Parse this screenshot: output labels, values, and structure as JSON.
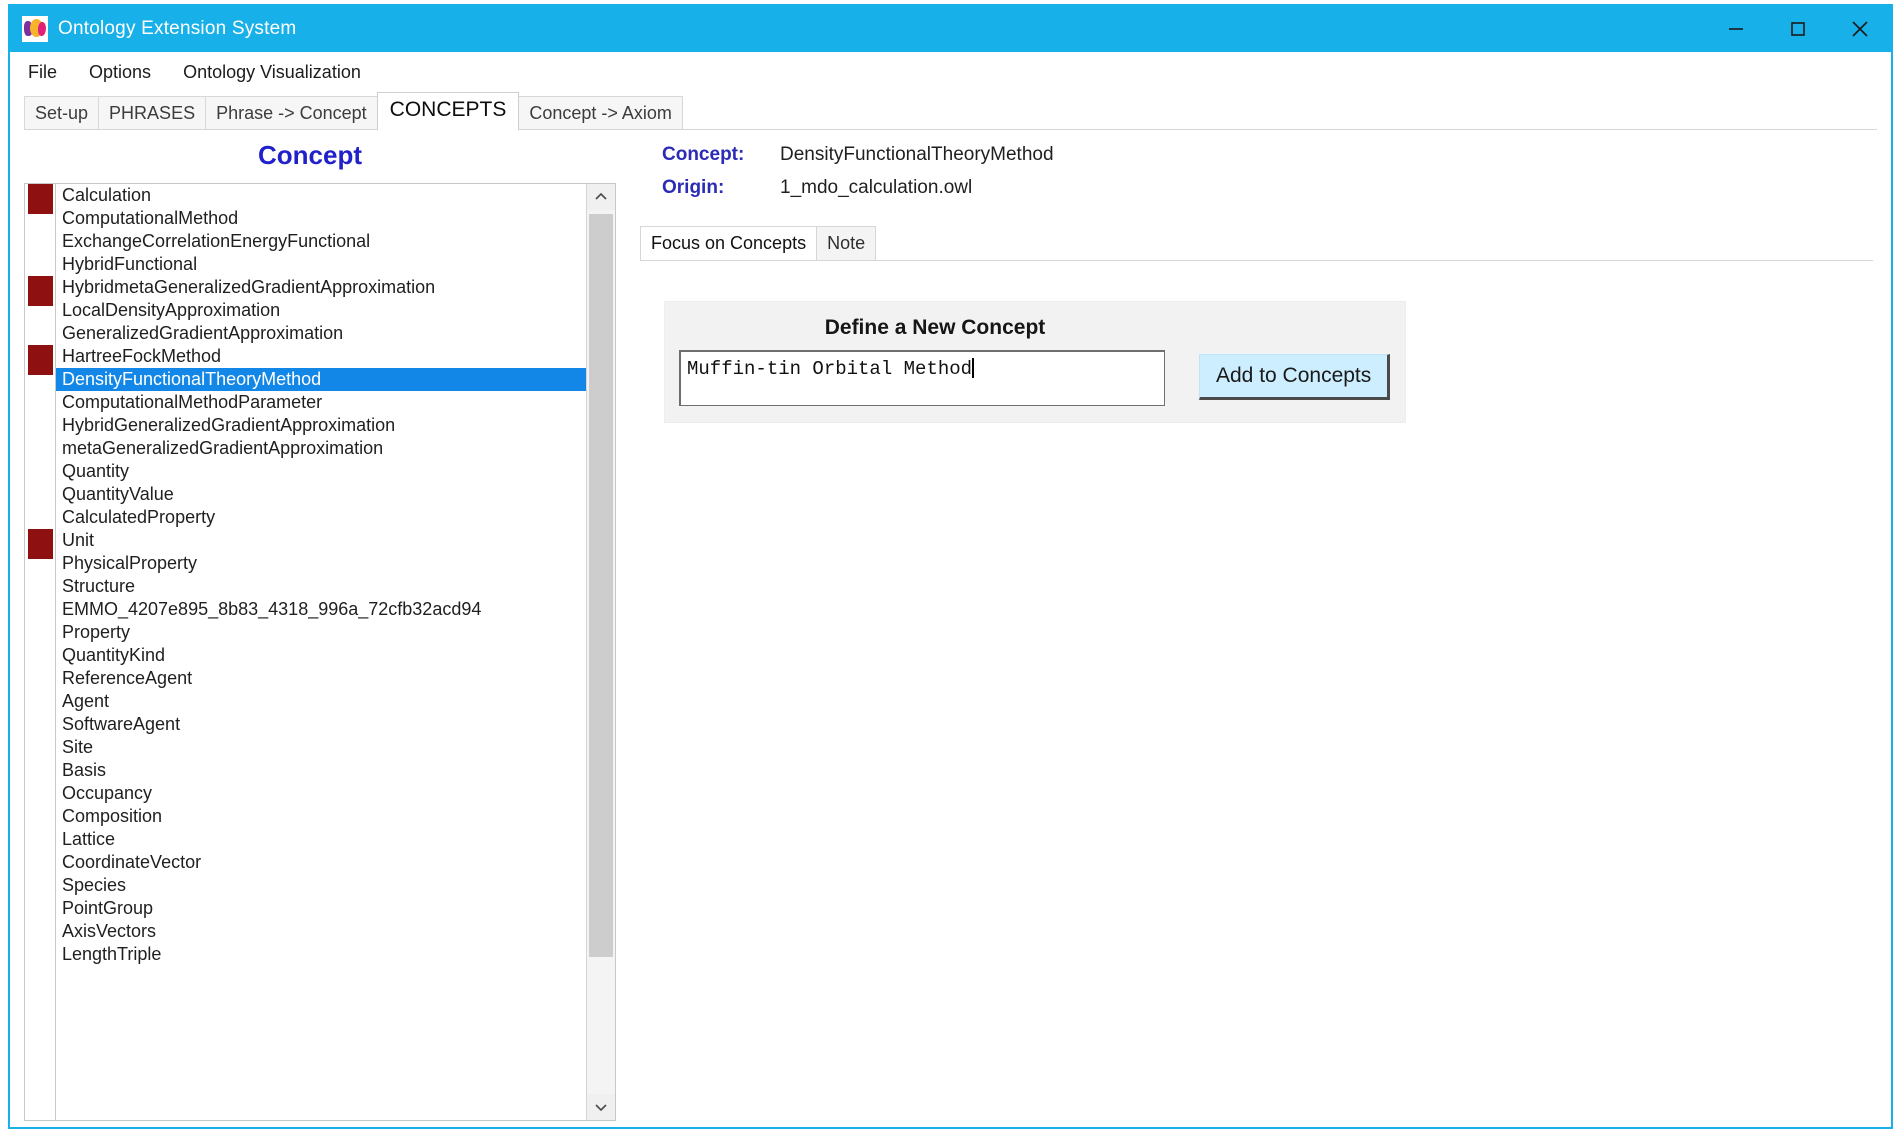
{
  "window": {
    "title": "Ontology Extension System",
    "icon": "app-logo-icon",
    "controls": {
      "minimize": "minimize-icon",
      "maximize": "maximize-icon",
      "close": "close-icon"
    }
  },
  "menubar": {
    "items": [
      {
        "label": "File"
      },
      {
        "label": "Options"
      },
      {
        "label": "Ontology Visualization"
      }
    ]
  },
  "tabs": {
    "active": "CONCEPTS",
    "items": [
      {
        "label": "Set-up"
      },
      {
        "label": "PHRASES"
      },
      {
        "label": "Phrase -> Concept"
      },
      {
        "label": "CONCEPTS"
      },
      {
        "label": "Concept -> Axiom"
      }
    ]
  },
  "left_pane": {
    "heading": "Concept",
    "selected": "DensityFunctionalTheoryMethod",
    "items": [
      {
        "label": "Calculation",
        "marker": true
      },
      {
        "label": "ComputationalMethod",
        "marker": false
      },
      {
        "label": "ExchangeCorrelationEnergyFunctional",
        "marker": false
      },
      {
        "label": "HybridFunctional",
        "marker": false
      },
      {
        "label": "HybridmetaGeneralizedGradientApproximation",
        "marker": true
      },
      {
        "label": "LocalDensityApproximation",
        "marker": false
      },
      {
        "label": "GeneralizedGradientApproximation",
        "marker": false
      },
      {
        "label": "HartreeFockMethod",
        "marker": true
      },
      {
        "label": "DensityFunctionalTheoryMethod",
        "marker": false,
        "selected": true
      },
      {
        "label": "ComputationalMethodParameter",
        "marker": false
      },
      {
        "label": "HybridGeneralizedGradientApproximation",
        "marker": false
      },
      {
        "label": "metaGeneralizedGradientApproximation",
        "marker": false
      },
      {
        "label": "Quantity",
        "marker": false
      },
      {
        "label": "QuantityValue",
        "marker": false
      },
      {
        "label": "CalculatedProperty",
        "marker": false
      },
      {
        "label": "Unit",
        "marker": true
      },
      {
        "label": "PhysicalProperty",
        "marker": false
      },
      {
        "label": "Structure",
        "marker": false
      },
      {
        "label": "EMMO_4207e895_8b83_4318_996a_72cfb32acd94",
        "marker": false
      },
      {
        "label": "Property",
        "marker": false
      },
      {
        "label": "QuantityKind",
        "marker": false
      },
      {
        "label": "ReferenceAgent",
        "marker": false
      },
      {
        "label": "Agent",
        "marker": false
      },
      {
        "label": "SoftwareAgent",
        "marker": false
      },
      {
        "label": "Site",
        "marker": false
      },
      {
        "label": "Basis",
        "marker": false
      },
      {
        "label": "Occupancy",
        "marker": false
      },
      {
        "label": "Composition",
        "marker": false
      },
      {
        "label": "Lattice",
        "marker": false
      },
      {
        "label": "CoordinateVector",
        "marker": false
      },
      {
        "label": "Species",
        "marker": false
      },
      {
        "label": "PointGroup",
        "marker": false
      },
      {
        "label": "AxisVectors",
        "marker": false
      },
      {
        "label": "LengthTriple",
        "marker": false
      }
    ],
    "scrollbar": {
      "up_icon": "chevron-up-icon",
      "down_icon": "chevron-down-icon"
    }
  },
  "right_pane": {
    "concept_label": "Concept:",
    "concept_value": "DensityFunctionalTheoryMethod",
    "origin_label": "Origin:",
    "origin_value": "1_mdo_calculation.owl",
    "inner_tabs": {
      "active": "Focus on Concepts",
      "items": [
        {
          "label": "Focus on Concepts"
        },
        {
          "label": "Note"
        }
      ]
    },
    "define_panel": {
      "title": "Define a New Concept",
      "input_value": "Muffin-tin Orbital Method",
      "input_placeholder": "",
      "button_label": "Add to Concepts"
    }
  },
  "colors": {
    "titlebar": "#17b0e8",
    "heading": "#2121cc",
    "meta_label": "#2b2bb5",
    "selection": "#1287e8",
    "marker": "#8f1010",
    "button": "#cceeff"
  }
}
